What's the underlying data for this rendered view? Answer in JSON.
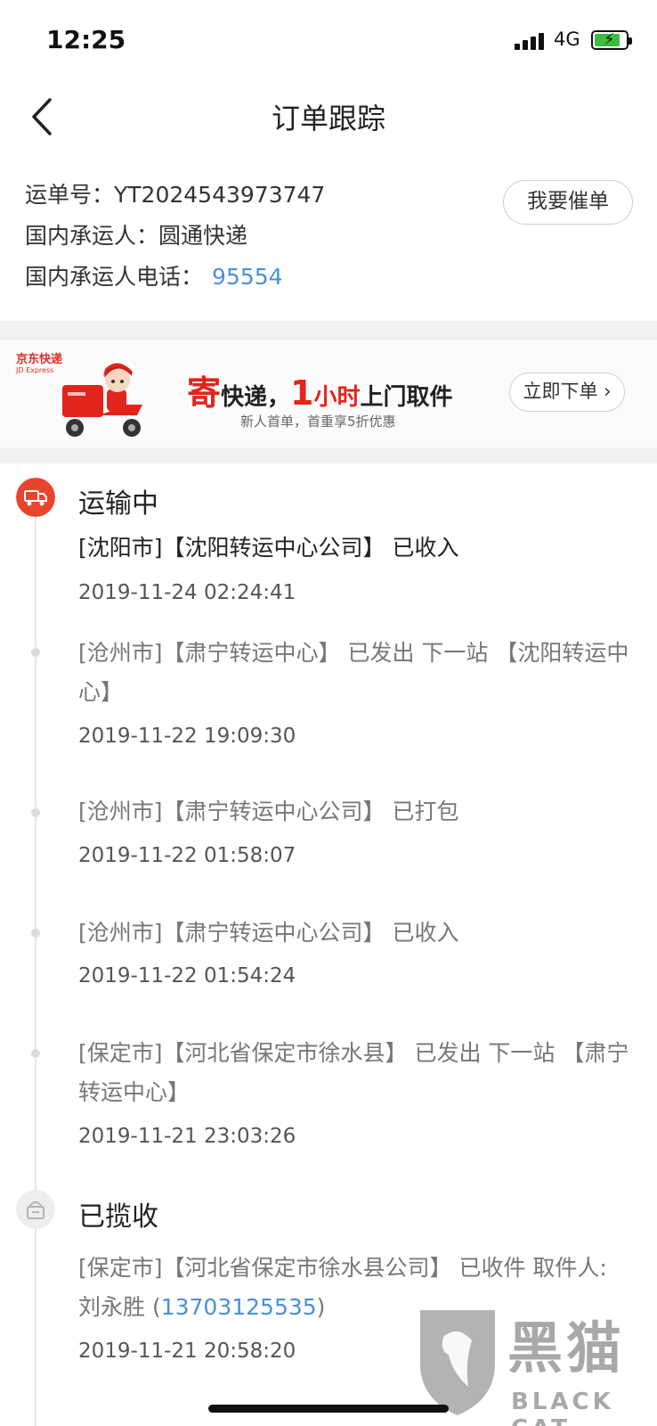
{
  "status_bar": {
    "time": "12:25",
    "network": "4G"
  },
  "nav": {
    "title": "订单跟踪"
  },
  "info": {
    "waybill_label": "运单号：",
    "waybill_no": "YT2024543973747",
    "carrier_label": "国内承运人：",
    "carrier": "圆通快递",
    "phone_label": "国内承运人电话：",
    "phone": "95554",
    "urge_button": "我要催单"
  },
  "banner": {
    "logo": "京东快递",
    "logo_en": "JD Express",
    "headline_1": "寄",
    "headline_2": "快递，",
    "headline_3": "1",
    "headline_4": "小时",
    "headline_5": "上门取件",
    "subtitle": "新人首单，首重享5折优惠",
    "order_button": "立即下单"
  },
  "timeline": {
    "in_transit_status": "运输中",
    "picked_up_status": "已揽收",
    "events": [
      {
        "text": "[沈阳市]【沈阳转运中心公司】 已收入",
        "time": "2019-11-24 02:24:41"
      },
      {
        "text": "[沧州市]【肃宁转运中心】 已发出 下一站 【沈阳转运中心】",
        "time": "2019-11-22 19:09:30"
      },
      {
        "text": "[沧州市]【肃宁转运中心公司】 已打包",
        "time": "2019-11-22 01:58:07"
      },
      {
        "text": "[沧州市]【肃宁转运中心公司】 已收入",
        "time": "2019-11-22 01:54:24"
      },
      {
        "text": "[保定市]【河北省保定市徐水县】 已发出 下一站 【肃宁转运中心】",
        "time": "2019-11-21 23:03:26"
      }
    ],
    "pickup_event": {
      "text_before": "[保定市]【河北省保定市徐水县公司】 已收件 取件人: 刘永胜 (",
      "phone": "13703125535",
      "text_after": ")",
      "time": "2019-11-21 20:58:20"
    }
  },
  "watermark": {
    "text": "黑猫",
    "sub": "BLACK CAT"
  },
  "colors": {
    "accent_red": "#e8452c",
    "link_blue": "#4a90d9"
  }
}
